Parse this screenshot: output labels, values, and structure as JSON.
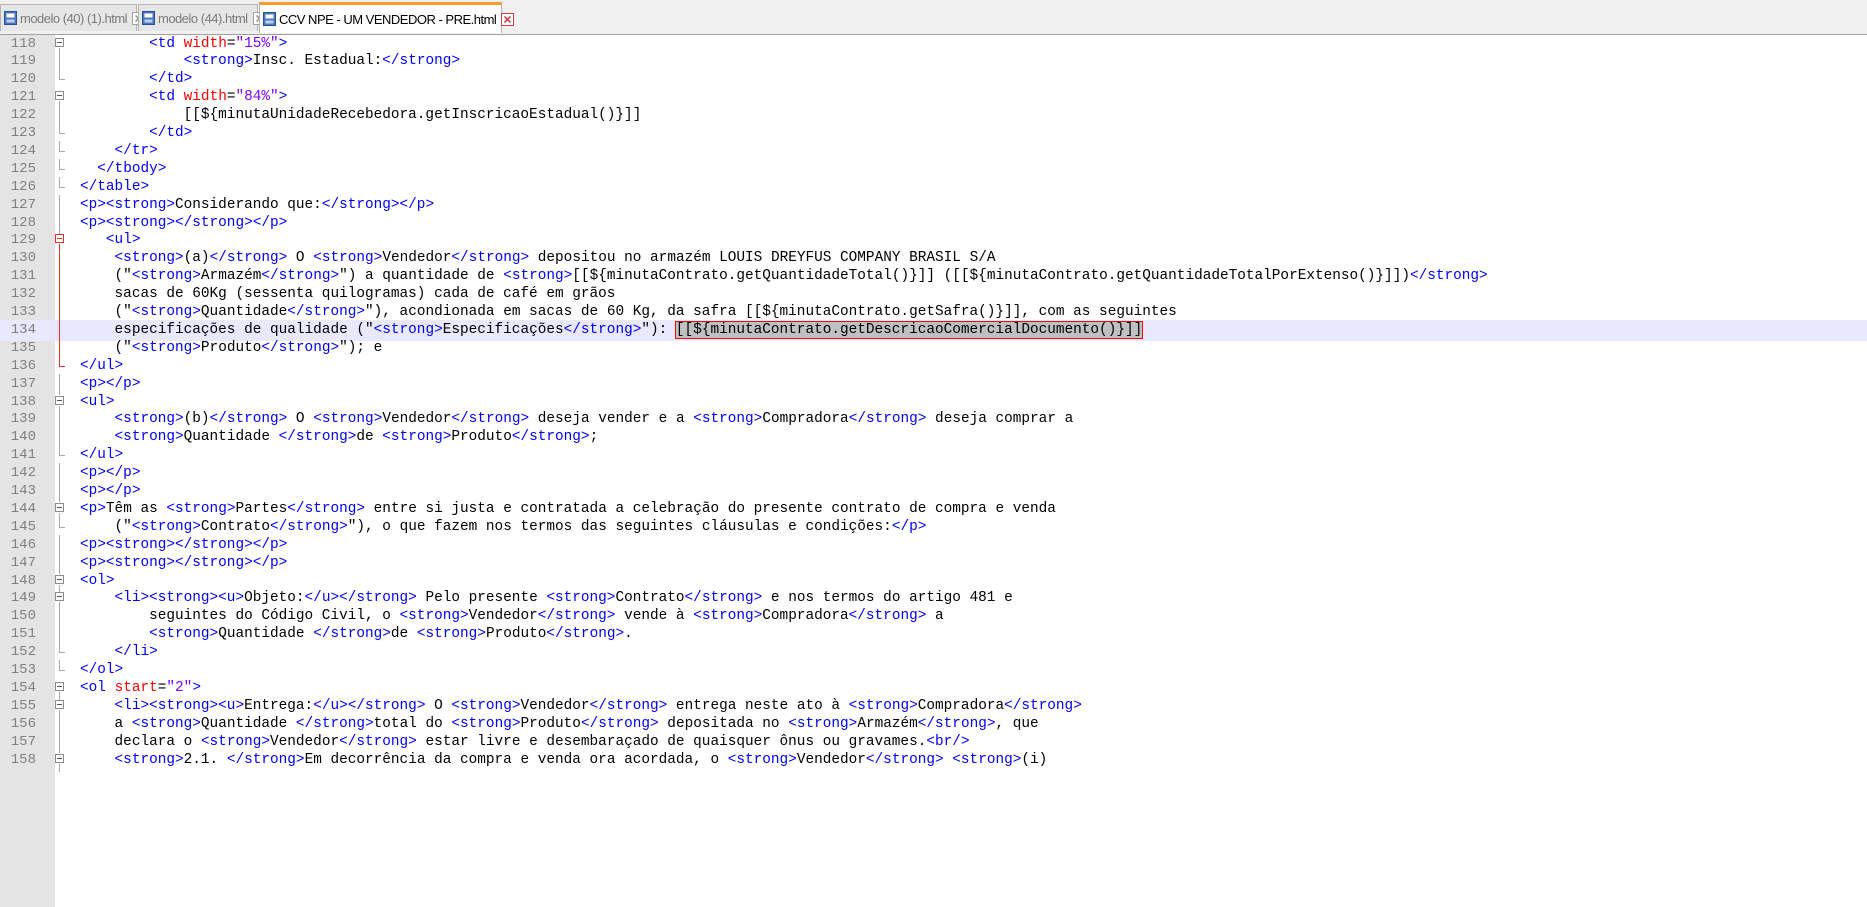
{
  "tabs": [
    {
      "label": "modelo (40) (1).html",
      "active": false
    },
    {
      "label": "modelo (44).html",
      "active": false
    },
    {
      "label": "CCV NPE - UM VENDEDOR -  PRE.html",
      "active": true
    }
  ],
  "editor": {
    "current_line": 134,
    "lines": [
      {
        "n": "118",
        "fold": "box",
        "segs": [
          {
            "x": "        "
          },
          {
            "t": "<td"
          },
          {
            "x": " "
          },
          {
            "a": "width"
          },
          {
            "x": "="
          },
          {
            "s": "\"15%\""
          },
          {
            "t": ">"
          }
        ]
      },
      {
        "n": "119",
        "fold": "line",
        "segs": [
          {
            "x": "            "
          },
          {
            "t": "<strong>"
          },
          {
            "x": "Insc. Estadual:"
          },
          {
            "t": "</strong>"
          }
        ]
      },
      {
        "n": "120",
        "fold": "end",
        "segs": [
          {
            "x": "        "
          },
          {
            "t": "</td>"
          }
        ]
      },
      {
        "n": "121",
        "fold": "box",
        "segs": [
          {
            "x": "        "
          },
          {
            "t": "<td"
          },
          {
            "x": " "
          },
          {
            "a": "width"
          },
          {
            "x": "="
          },
          {
            "s": "\"84%\""
          },
          {
            "t": ">"
          }
        ]
      },
      {
        "n": "122",
        "fold": "line",
        "segs": [
          {
            "x": "            [[${minutaUnidadeRecebedora.getInscricaoEstadual()}]]"
          }
        ]
      },
      {
        "n": "123",
        "fold": "end",
        "segs": [
          {
            "x": "        "
          },
          {
            "t": "</td>"
          }
        ]
      },
      {
        "n": "124",
        "fold": "end",
        "segs": [
          {
            "x": "    "
          },
          {
            "t": "</tr>"
          }
        ]
      },
      {
        "n": "125",
        "fold": "end",
        "segs": [
          {
            "x": "  "
          },
          {
            "t": "</tbody>"
          }
        ]
      },
      {
        "n": "126",
        "fold": "end",
        "segs": [
          {
            "t": "</table>"
          }
        ]
      },
      {
        "n": "127",
        "fold": "line",
        "segs": [
          {
            "t": "<p><strong>"
          },
          {
            "x": "Considerando que:"
          },
          {
            "t": "</strong></p>"
          }
        ]
      },
      {
        "n": "128",
        "fold": "line",
        "segs": [
          {
            "t": "<p><strong></strong></p>"
          }
        ]
      },
      {
        "n": "129",
        "fold": "boxred",
        "segs": [
          {
            "x": "   "
          },
          {
            "t": "<ul>"
          }
        ]
      },
      {
        "n": "130",
        "fold": "linered",
        "segs": [
          {
            "x": "    "
          },
          {
            "t": "<strong>"
          },
          {
            "x": "(a)"
          },
          {
            "t": "</strong>"
          },
          {
            "x": " O "
          },
          {
            "t": "<strong>"
          },
          {
            "x": "Vendedor"
          },
          {
            "t": "</strong>"
          },
          {
            "x": " depositou no armazém LOUIS DREYFUS COMPANY BRASIL S/A"
          }
        ]
      },
      {
        "n": "131",
        "fold": "linered",
        "segs": [
          {
            "x": "    (\""
          },
          {
            "t": "<strong>"
          },
          {
            "x": "Armazém"
          },
          {
            "t": "</strong>"
          },
          {
            "x": "\") a quantidade de "
          },
          {
            "t": "<strong>"
          },
          {
            "x": "[[${minutaContrato.getQuantidadeTotal()}]] ([[${minutaContrato.getQuantidadeTotalPorExtenso()}]])"
          },
          {
            "t": "</strong>"
          }
        ]
      },
      {
        "n": "132",
        "fold": "linered",
        "segs": [
          {
            "x": "    sacas de 60Kg (sessenta quilogramas) cada de café em grãos"
          }
        ]
      },
      {
        "n": "133",
        "fold": "linered",
        "segs": [
          {
            "x": "    (\""
          },
          {
            "t": "<strong>"
          },
          {
            "x": "Quantidade"
          },
          {
            "t": "</strong>"
          },
          {
            "x": "\"), acondionada em sacas de 60 Kg, da safra [[${minutaContrato.getSafra()}]], com as seguintes"
          }
        ]
      },
      {
        "n": "134",
        "fold": "linered",
        "segs": [
          {
            "x": "    especificações de qualidade (\""
          },
          {
            "t": "<strong>"
          },
          {
            "x": "Especificações"
          },
          {
            "t": "</strong>"
          },
          {
            "x": "\"): "
          },
          {
            "sel": "[[${minutaContrato.getDescricaoComercialDocumento()}]]"
          }
        ]
      },
      {
        "n": "135",
        "fold": "linered",
        "segs": [
          {
            "x": "    (\""
          },
          {
            "t": "<strong>"
          },
          {
            "x": "Produto"
          },
          {
            "t": "</strong>"
          },
          {
            "x": "\"); e"
          }
        ]
      },
      {
        "n": "136",
        "fold": "endred",
        "segs": [
          {
            "t": "</ul>"
          }
        ]
      },
      {
        "n": "137",
        "fold": "line",
        "segs": [
          {
            "t": "<p></p>"
          }
        ]
      },
      {
        "n": "138",
        "fold": "box",
        "segs": [
          {
            "t": "<ul>"
          }
        ]
      },
      {
        "n": "139",
        "fold": "line",
        "segs": [
          {
            "x": "    "
          },
          {
            "t": "<strong>"
          },
          {
            "x": "(b)"
          },
          {
            "t": "</strong>"
          },
          {
            "x": " O "
          },
          {
            "t": "<strong>"
          },
          {
            "x": "Vendedor"
          },
          {
            "t": "</strong>"
          },
          {
            "x": " deseja vender e a "
          },
          {
            "t": "<strong>"
          },
          {
            "x": "Compradora"
          },
          {
            "t": "</strong>"
          },
          {
            "x": " deseja comprar a"
          }
        ]
      },
      {
        "n": "140",
        "fold": "line",
        "segs": [
          {
            "x": "    "
          },
          {
            "t": "<strong>"
          },
          {
            "x": "Quantidade "
          },
          {
            "t": "</strong>"
          },
          {
            "x": "de "
          },
          {
            "t": "<strong>"
          },
          {
            "x": "Produto"
          },
          {
            "t": "</strong>"
          },
          {
            "x": ";"
          }
        ]
      },
      {
        "n": "141",
        "fold": "end",
        "segs": [
          {
            "t": "</ul>"
          }
        ]
      },
      {
        "n": "142",
        "fold": "line",
        "segs": [
          {
            "t": "<p></p>"
          }
        ]
      },
      {
        "n": "143",
        "fold": "line",
        "segs": [
          {
            "t": "<p></p>"
          }
        ]
      },
      {
        "n": "144",
        "fold": "box",
        "segs": [
          {
            "t": "<p>"
          },
          {
            "x": "Têm as "
          },
          {
            "t": "<strong>"
          },
          {
            "x": "Partes"
          },
          {
            "t": "</strong>"
          },
          {
            "x": " entre si justa e contratada a celebração do presente contrato de compra e venda"
          }
        ]
      },
      {
        "n": "145",
        "fold": "end",
        "segs": [
          {
            "x": "    (\""
          },
          {
            "t": "<strong>"
          },
          {
            "x": "Contrato"
          },
          {
            "t": "</strong>"
          },
          {
            "x": "\"), o que fazem nos termos das seguintes cláusulas e condições:"
          },
          {
            "t": "</p>"
          }
        ]
      },
      {
        "n": "146",
        "fold": "line",
        "segs": [
          {
            "t": "<p><strong></strong></p>"
          }
        ]
      },
      {
        "n": "147",
        "fold": "line",
        "segs": [
          {
            "t": "<p><strong></strong></p>"
          }
        ]
      },
      {
        "n": "148",
        "fold": "box",
        "segs": [
          {
            "t": "<ol>"
          }
        ]
      },
      {
        "n": "149",
        "fold": "box",
        "segs": [
          {
            "x": "    "
          },
          {
            "t": "<li><strong><u>"
          },
          {
            "x": "Objeto:"
          },
          {
            "t": "</u></strong>"
          },
          {
            "x": " Pelo presente "
          },
          {
            "t": "<strong>"
          },
          {
            "x": "Contrato"
          },
          {
            "t": "</strong>"
          },
          {
            "x": " e nos termos do artigo 481 e"
          }
        ]
      },
      {
        "n": "150",
        "fold": "line",
        "segs": [
          {
            "x": "        seguintes do Código Civil, o "
          },
          {
            "t": "<strong>"
          },
          {
            "x": "Vendedor"
          },
          {
            "t": "</strong>"
          },
          {
            "x": " vende à "
          },
          {
            "t": "<strong>"
          },
          {
            "x": "Compradora"
          },
          {
            "t": "</strong>"
          },
          {
            "x": " a"
          }
        ]
      },
      {
        "n": "151",
        "fold": "line",
        "segs": [
          {
            "x": "        "
          },
          {
            "t": "<strong>"
          },
          {
            "x": "Quantidade "
          },
          {
            "t": "</strong>"
          },
          {
            "x": "de "
          },
          {
            "t": "<strong>"
          },
          {
            "x": "Produto"
          },
          {
            "t": "</strong>"
          },
          {
            "x": "."
          }
        ]
      },
      {
        "n": "152",
        "fold": "end",
        "segs": [
          {
            "x": "    "
          },
          {
            "t": "</li>"
          }
        ]
      },
      {
        "n": "153",
        "fold": "end",
        "segs": [
          {
            "t": "</ol>"
          }
        ]
      },
      {
        "n": "154",
        "fold": "box",
        "segs": [
          {
            "t": "<ol"
          },
          {
            "x": " "
          },
          {
            "a": "start"
          },
          {
            "x": "="
          },
          {
            "s": "\"2\""
          },
          {
            "t": ">"
          }
        ]
      },
      {
        "n": "155",
        "fold": "box",
        "segs": [
          {
            "x": "    "
          },
          {
            "t": "<li><strong><u>"
          },
          {
            "x": "Entrega:"
          },
          {
            "t": "</u></strong>"
          },
          {
            "x": " O "
          },
          {
            "t": "<strong>"
          },
          {
            "x": "Vendedor"
          },
          {
            "t": "</strong>"
          },
          {
            "x": " entrega neste ato à "
          },
          {
            "t": "<strong>"
          },
          {
            "x": "Compradora"
          },
          {
            "t": "</strong>"
          }
        ]
      },
      {
        "n": "156",
        "fold": "line",
        "segs": [
          {
            "x": "    a "
          },
          {
            "t": "<strong>"
          },
          {
            "x": "Quantidade "
          },
          {
            "t": "</strong>"
          },
          {
            "x": "total do "
          },
          {
            "t": "<strong>"
          },
          {
            "x": "Produto"
          },
          {
            "t": "</strong>"
          },
          {
            "x": " depositada no "
          },
          {
            "t": "<strong>"
          },
          {
            "x": "Armazém"
          },
          {
            "t": "</strong>"
          },
          {
            "x": ", que"
          }
        ]
      },
      {
        "n": "157",
        "fold": "line",
        "segs": [
          {
            "x": "    declara o "
          },
          {
            "t": "<strong>"
          },
          {
            "x": "Vendedor"
          },
          {
            "t": "</strong>"
          },
          {
            "x": " estar livre e desembaraçado de quaisquer ônus ou gravames."
          },
          {
            "t": "<br/>"
          }
        ]
      },
      {
        "n": "158",
        "fold": "box",
        "segs": [
          {
            "x": "    "
          },
          {
            "t": "<strong>"
          },
          {
            "x": "2.1. "
          },
          {
            "t": "</strong>"
          },
          {
            "x": "Em decorrência da compra e venda ora acordada, o "
          },
          {
            "t": "<strong>"
          },
          {
            "x": "Vendedor"
          },
          {
            "t": "</strong>"
          },
          {
            "x": " "
          },
          {
            "t": "<strong>"
          },
          {
            "x": "(i)"
          }
        ]
      }
    ]
  }
}
